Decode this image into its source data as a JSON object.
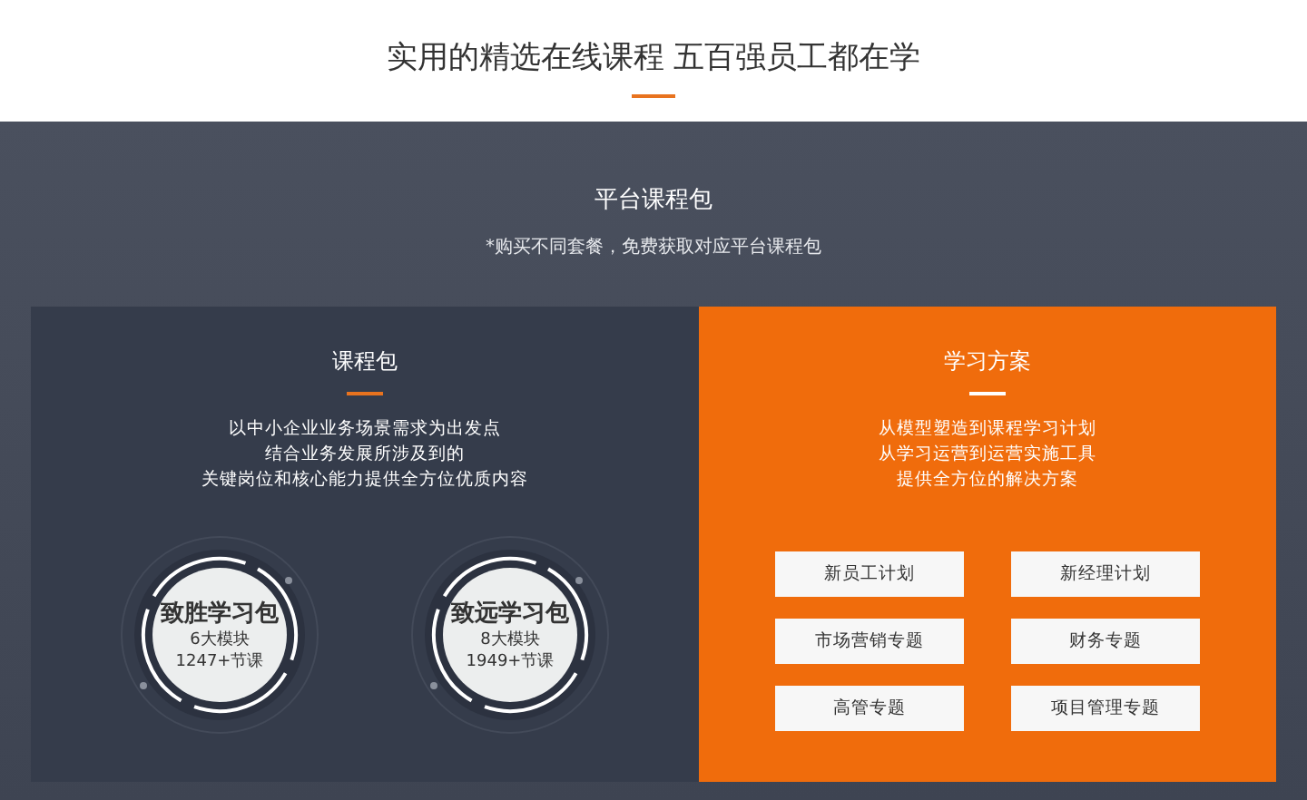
{
  "header": {
    "title": "实用的精选在线课程 五百强员工都在学"
  },
  "section": {
    "title": "平台课程包",
    "note": "*购买不同套餐，免费获取对应平台课程包"
  },
  "course_card": {
    "title": "课程包",
    "description": [
      "以中小企业业务场景需求为出发点",
      "结合业务发展所涉及到的",
      "关键岗位和核心能力提供全方位优质内容"
    ],
    "packages": [
      {
        "name": "致胜学习包",
        "modules": "6大模块",
        "lessons": "1247+节课"
      },
      {
        "name": "致远学习包",
        "modules": "8大模块",
        "lessons": "1949+节课"
      }
    ]
  },
  "plan_card": {
    "title": "学习方案",
    "description": [
      "从模型塑造到课程学习计划",
      "从学习运营到运营实施工具",
      "提供全方位的解决方案"
    ],
    "buttons": [
      "新员工计划",
      "新经理计划",
      "市场营销专题",
      "财务专题",
      "高管专题",
      "项目管理专题"
    ]
  }
}
